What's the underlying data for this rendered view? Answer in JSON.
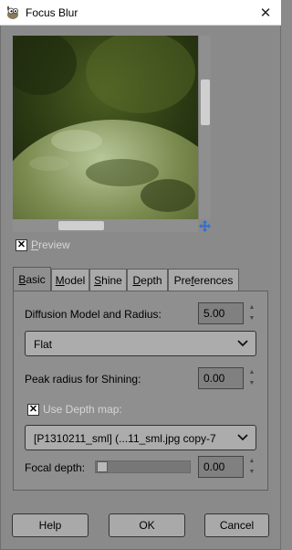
{
  "window": {
    "title": "Focus Blur",
    "app_icon": "gimp-wilber-icon",
    "close_icon": "close-x-icon"
  },
  "preview": {
    "checkbox_checked": true,
    "label": "Preview",
    "nav_icon": "navigate-move-icon"
  },
  "tabs": [
    {
      "label": "Basic",
      "mnemonic_index": 0,
      "active": true
    },
    {
      "label": "Model",
      "mnemonic_index": 0,
      "active": false
    },
    {
      "label": "Shine",
      "mnemonic_index": 0,
      "active": false
    },
    {
      "label": "Depth",
      "mnemonic_index": 0,
      "active": false
    },
    {
      "label": "Preferences",
      "mnemonic_index": 3,
      "active": false
    }
  ],
  "basic": {
    "diffusion_label": "Diffusion Model and Radius:",
    "diffusion_value": "5.00",
    "model_selected": "Flat",
    "peak_label": "Peak radius for Shining:",
    "peak_value": "0.00",
    "depth_map_label": "Use Depth map:",
    "depth_map_checked": true,
    "depth_map_selected": "[P1310211_sml] (...11_sml.jpg copy-7",
    "focal_label": "Focal depth:",
    "focal_value": "0.00",
    "focal_fraction": 0.0
  },
  "buttons": {
    "help": "Help",
    "ok": "OK",
    "cancel": "Cancel"
  },
  "colors": {
    "dialog_bg": "#8a8a8a",
    "panel_bg": "#8f8f8f",
    "disabled_text": "#d6d6d6"
  }
}
